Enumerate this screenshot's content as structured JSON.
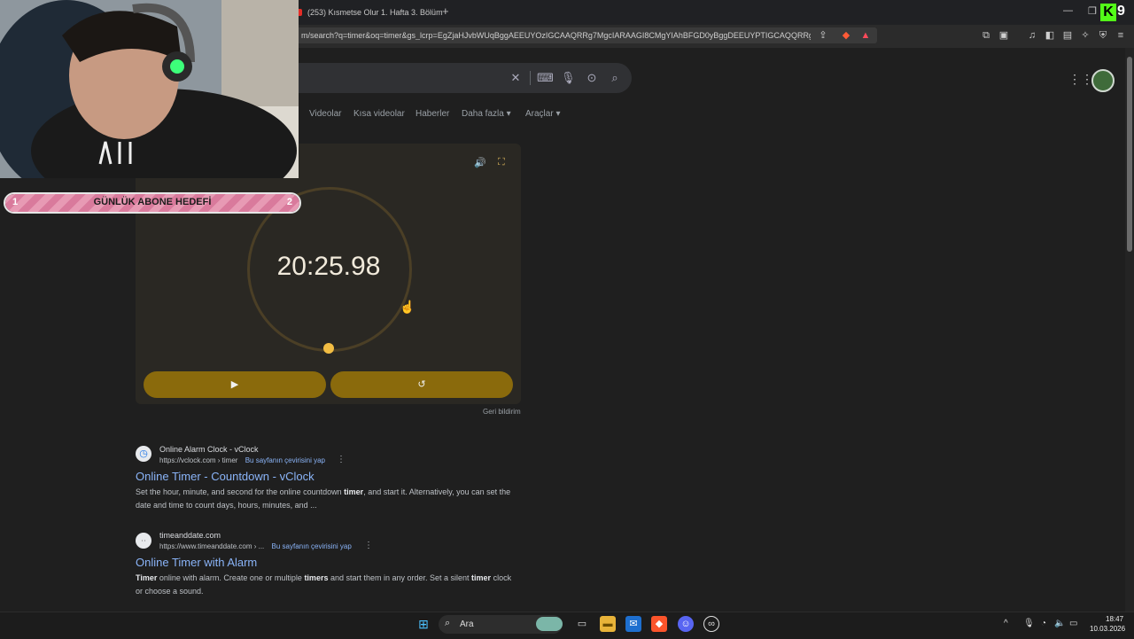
{
  "browser": {
    "tab_title": "(253) Kısmetse Olur 1. Hafta 3. Bölüm",
    "new_tab_label": "+",
    "url": "m/search?q=timer&oq=timer&gs_lcrp=EgZjaHJvbWUqBggAEEUYOzIGCAAQRRg7MgcIARAAGI8CMgYIAhBFGD0yBggDEEUYPTIGCAQQRRg..."
  },
  "search": {
    "filters": [
      "Videolar",
      "Kısa videolar",
      "Haberler",
      "Daha fazla ▾",
      "Araçlar ▾"
    ]
  },
  "timer": {
    "display": "20:25.98",
    "play_icon": "▶",
    "reset_icon": "↺",
    "sound_icon": "🔊",
    "fullscreen_icon": "⛶",
    "feedback": "Geri bildirim"
  },
  "results": [
    {
      "site_name": "Online Alarm Clock - vClock",
      "url": "https://vclock.com › timer",
      "translate": "Bu sayfanın çevirisini yap",
      "title": "Online Timer - Countdown - vClock",
      "snippet_html": "Set the hour, minute, and second for the online countdown <b>timer</b>, and start it. Alternatively, you can set the date and time to count days, hours, minutes, and ..."
    },
    {
      "site_name": "timeanddate.com",
      "url": "https://www.timeanddate.com › ...",
      "translate": "Bu sayfanın çevirisini yap",
      "title": "Online Timer with Alarm",
      "snippet_html": "<b>Timer</b> online with alarm. Create one or multiple <b>timers</b> and start them in any order. Set a silent <b>timer</b> clock or choose a sound."
    }
  ],
  "overlay": {
    "goal_label": "GÜNLÜK ABONE HEDEFİ",
    "goal_current": "1",
    "goal_target": "2",
    "brand_k": "K",
    "brand_nine": "9"
  },
  "taskbar": {
    "search_label": "Ara",
    "time": "18:47",
    "date": "10.03.2026"
  }
}
